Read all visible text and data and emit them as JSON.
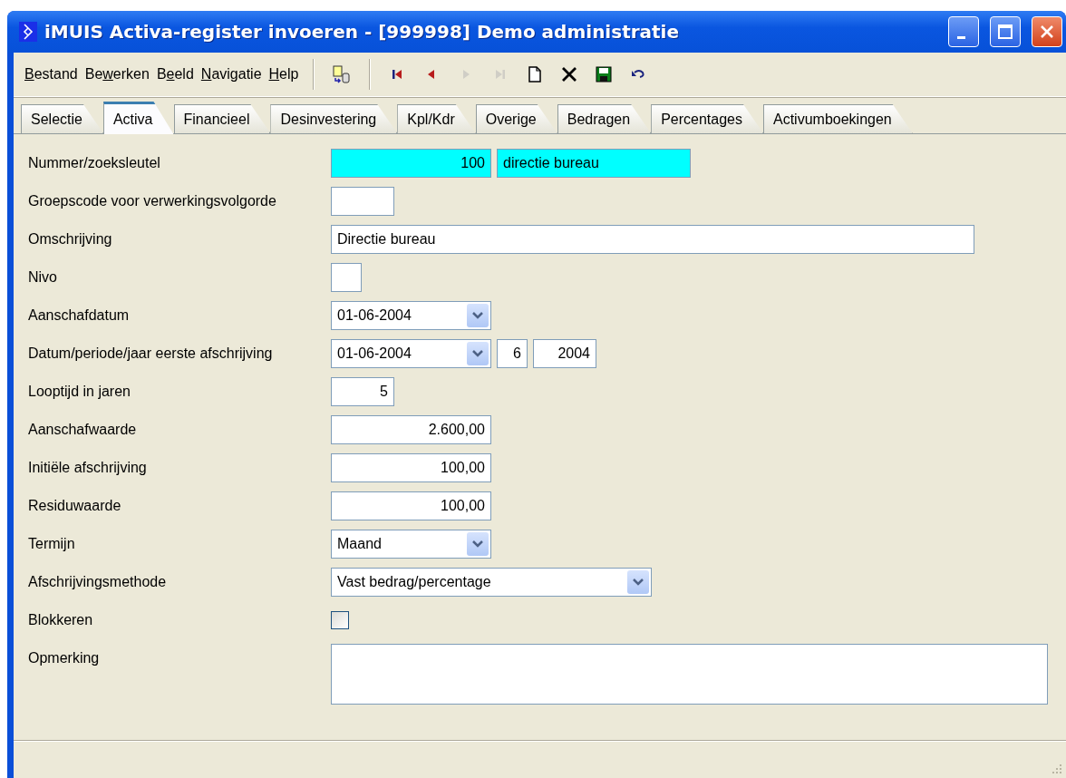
{
  "window": {
    "title": "iMUIS Activa-register invoeren - [999998] Demo administratie"
  },
  "menu": [
    {
      "key": "B",
      "after": "estand"
    },
    {
      "before": "Be",
      "key": "w",
      "after": "erken"
    },
    {
      "before": "B",
      "key": "e",
      "after": "eld"
    },
    {
      "key": "N",
      "after": "avigatie"
    },
    {
      "key": "H",
      "after": "elp"
    }
  ],
  "toolbar_groups": [
    [
      {
        "kind": "import",
        "disabled": false
      }
    ],
    [
      {
        "kind": "first",
        "disabled": false
      },
      {
        "kind": "previous",
        "disabled": false
      },
      {
        "kind": "next",
        "disabled": true
      },
      {
        "kind": "last",
        "disabled": true
      },
      {
        "kind": "new",
        "disabled": false
      },
      {
        "kind": "delete",
        "disabled": false
      },
      {
        "kind": "save",
        "disabled": false
      },
      {
        "kind": "undo",
        "disabled": false
      }
    ]
  ],
  "tabs": [
    {
      "label": "Selectie",
      "selected": false
    },
    {
      "label": "Activa",
      "selected": true
    },
    {
      "label": "Financieel",
      "selected": false
    },
    {
      "label": "Desinvestering",
      "selected": false
    },
    {
      "label": "Kpl/Kdr",
      "selected": false
    },
    {
      "label": "Overige",
      "selected": false
    },
    {
      "label": "Bedragen",
      "selected": false
    },
    {
      "label": "Percentages",
      "selected": false
    },
    {
      "label": "Activumboekingen",
      "selected": false
    }
  ],
  "form": [
    {
      "label": "Nummer/zoeksleutel",
      "controls": [
        {
          "kind": "number",
          "value": "100",
          "highlighted": true
        },
        {
          "kind": "text",
          "value": "directie bureau",
          "highlighted": true
        }
      ]
    },
    {
      "label": "Groepscode voor verwerkingsvolgorde",
      "controls": [
        {
          "kind": "text",
          "highlighted": false
        }
      ]
    },
    {
      "label": "Omschrijving",
      "controls": [
        {
          "kind": "text",
          "value": "Directie bureau",
          "highlighted": false
        }
      ]
    },
    {
      "label": "Nivo",
      "controls": [
        {
          "kind": "text",
          "highlighted": false
        }
      ]
    },
    {
      "label": "Aanschafdatum",
      "controls": [
        {
          "kind": "combo",
          "value": "01-06-2004"
        }
      ]
    },
    {
      "label": "Datum/periode/jaar eerste afschrijving",
      "controls": [
        {
          "kind": "combo",
          "value": "01-06-2004"
        },
        {
          "kind": "number",
          "value": "6",
          "highlighted": false
        },
        {
          "kind": "number",
          "value": "2004",
          "highlighted": false
        }
      ]
    },
    {
      "label": "Looptijd in jaren",
      "controls": [
        {
          "kind": "number",
          "value": "5",
          "highlighted": false
        }
      ]
    },
    {
      "label": "Aanschafwaarde",
      "controls": [
        {
          "kind": "number",
          "value": "2.600,00",
          "highlighted": false
        }
      ]
    },
    {
      "label": "Initiële afschrijving",
      "controls": [
        {
          "kind": "number",
          "value": "100,00",
          "highlighted": false
        }
      ]
    },
    {
      "label": "Residuwaarde",
      "controls": [
        {
          "kind": "number",
          "value": "100,00",
          "highlighted": false
        }
      ]
    },
    {
      "label": "Termijn",
      "controls": [
        {
          "kind": "combo",
          "value": "Maand"
        }
      ]
    },
    {
      "label": "Afschrijvingsmethode",
      "controls": [
        {
          "kind": "combo",
          "value": "Vast bedrag/percentage"
        }
      ]
    },
    {
      "label": "Blokkeren",
      "controls": [
        {
          "kind": "checkbox",
          "checked": false
        }
      ]
    },
    {
      "label": "Opmerking",
      "controls": [
        {
          "kind": "memo"
        }
      ]
    }
  ]
}
